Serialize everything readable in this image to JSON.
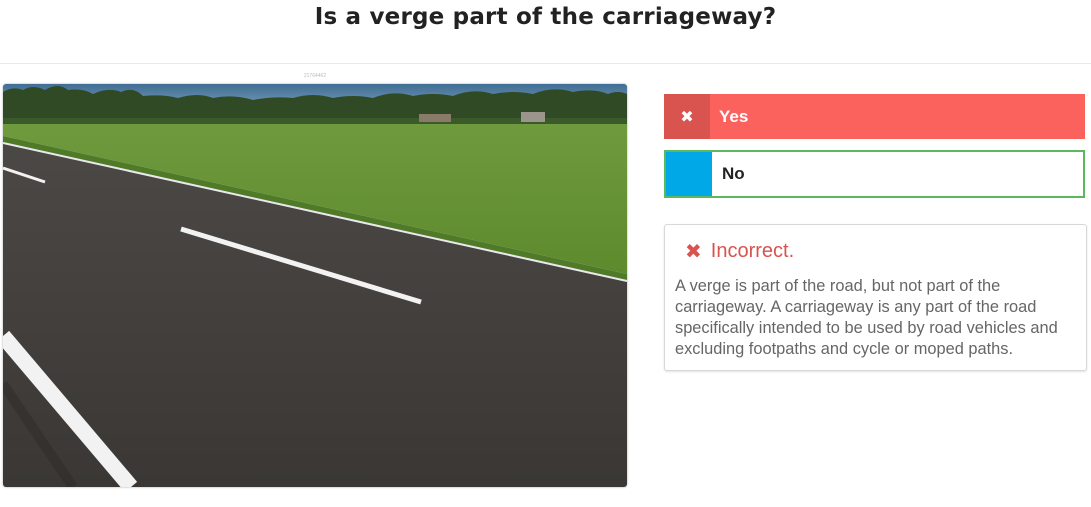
{
  "question": {
    "title": "Is a verge part of the carriageway?"
  },
  "image": {
    "caption": "21764462",
    "alt": "Country road with grass verge and fields"
  },
  "answers": [
    {
      "label": "Yes",
      "state": "selected-incorrect",
      "icon": "close-icon",
      "color": "#fb625e"
    },
    {
      "label": "No",
      "state": "correct",
      "color": "#00a8e8",
      "border_color": "#5cb85c"
    }
  ],
  "feedback": {
    "status": "Incorrect.",
    "icon": "close-icon",
    "status_color": "#d9534f",
    "explanation": "A verge is part of the road, but not part of the carriageway. A carriageway is any part of the road specifically intended to be used by road vehicles and excluding footpaths and cycle or moped paths."
  }
}
